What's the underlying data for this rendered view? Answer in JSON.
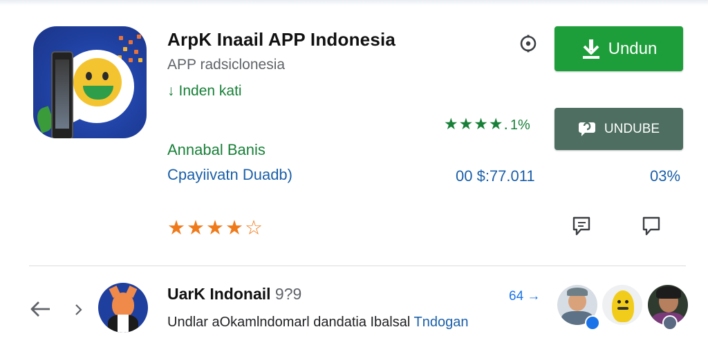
{
  "app": {
    "title": "ArpK Inaail APP Indonesia",
    "subtitle": "APP radsiclonesia",
    "installed_label": "Inden kati",
    "icon": "app-logo-icon"
  },
  "actions": {
    "download_label": "Undun",
    "unsubscribe_label": "UNDUBE"
  },
  "rating": {
    "green_stars": "★★★★.",
    "green_value": "1%",
    "orange_stars": "★★★★☆"
  },
  "stats": {
    "label_green": "Annabal Banis",
    "label_blue": "Cpayiivatn Duadb)",
    "value_blue": "00 $:77.011",
    "percent_blue": "03%"
  },
  "review": {
    "user_name": "UarK Indonail",
    "user_number": "9?9",
    "desc_prefix": "Undlar a",
    "desc_mid": "Okamlndomarl dandatia Ibalsal",
    "desc_link": "Tndogan",
    "count_link": "64",
    "count_arrow": "→"
  },
  "colors": {
    "download_green": "#1e9e3a",
    "unsubscribe_gray_green": "#4d6e60",
    "text_green": "#188038",
    "text_blue": "#1a5fa8",
    "star_orange": "#ef7a1a"
  },
  "icons": [
    "settings-icon",
    "download-icon",
    "chat-icon",
    "flag-icon",
    "comment-icon",
    "back-arrow-icon",
    "chevron-right-icon"
  ]
}
